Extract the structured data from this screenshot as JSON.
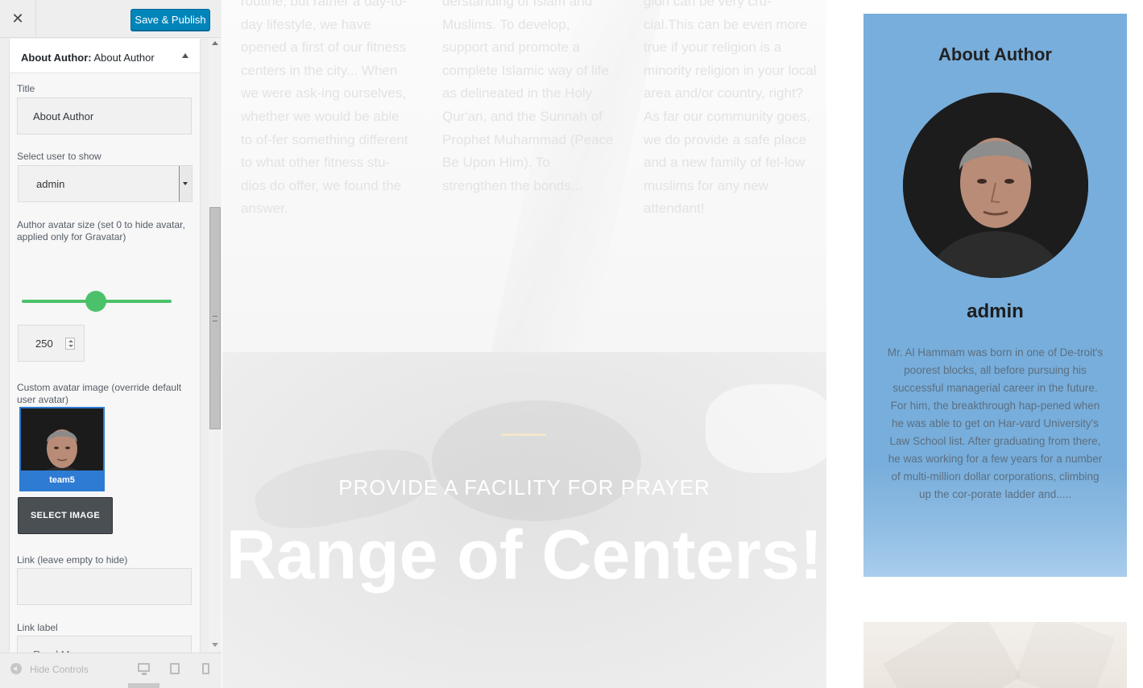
{
  "sidebar": {
    "close_glyph": "✕",
    "publish_label": "Save & Publish",
    "widget": {
      "type_label": "About Author:",
      "instance_label": "About Author"
    },
    "fields": {
      "title_label": "Title",
      "title_value": "About Author",
      "user_label": "Select user to show",
      "user_value": "admin",
      "avatar_size_label": "Author avatar size (set 0 to hide avatar, applied only for Gravatar)",
      "avatar_size_value": "250",
      "custom_avatar_label": "Custom avatar image (override default user avatar)",
      "avatar_caption": "team5",
      "select_image_label": "SELECT IMAGE",
      "link_label": "Link (leave empty to hide)",
      "link_value": "",
      "link_text_label": "Link label",
      "link_text_placeholder": "Read More"
    },
    "footer": {
      "hide_controls_label": "Hide Controls"
    }
  },
  "preview": {
    "col1_text": "routine, but rather a day-to-day lifestyle, we have opened a first of our fitness centers in the city... When we were ask-ing ourselves, whether we would be able to of-fer something different to what other fitness stu-dios do offer, we found the answer.",
    "col2_text": "derstanding of Islam and Muslims. To develop, support and promote a complete Islamic way of life as delineated in the Holy Qur'an, and the Sunnah of Prophet Muhammad (Peace Be Upon Him). To strengthen the bonds...",
    "col3_text": "gion can be very cru-cial.This can be even more true if your religion is a minority religion in your local area and/or country, right?As far our community goes, we do provide a safe place and a new family of fel-low muslims for any new attendant!",
    "hero_subtitle": "PROVIDE A FACILITY FOR PRAYER",
    "hero_title": "Range of Centers!",
    "author_card": {
      "title": "About Author",
      "name": "admin",
      "bio": "Mr. Al Hammam was born in one of De-troit's poorest blocks, all before pursuing his successful managerial career in the future. For him, the breakthrough hap-pened when he was able to get on Har-vard University's Law School list. After graduating from there, he was working for a few years for a number of multi-million dollar corporations, climbing up the cor-porate ladder and....."
    }
  },
  "colors": {
    "publish_blue": "#0085ba",
    "slider_green": "#4bc26a",
    "card_blue": "#78aedb"
  },
  "icons": {
    "close": "close-icon",
    "collapse": "chevron-up-icon",
    "select_dropdown": "chevron-down-icon",
    "hide_controls": "arrow-left-circle-icon",
    "desktop": "desktop-icon",
    "tablet": "tablet-icon",
    "mobile": "mobile-icon"
  }
}
